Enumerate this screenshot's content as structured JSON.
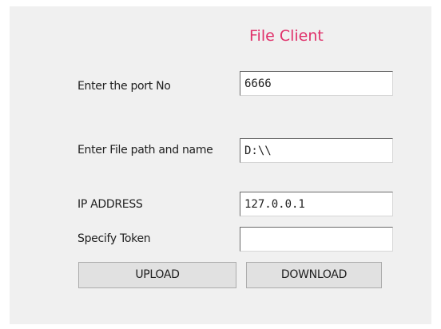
{
  "window": {
    "title": "File Client"
  },
  "form": {
    "port": {
      "label": "Enter the port No",
      "value": "6666"
    },
    "file_path": {
      "label": "Enter File path and name",
      "value": "D:\\\\"
    },
    "ip_address": {
      "label": "IP ADDRESS",
      "value": "127.0.0.1"
    },
    "token": {
      "label": "Specify Token",
      "value": ""
    }
  },
  "buttons": {
    "upload_label": "UPLOAD",
    "download_label": "DOWNLOAD"
  },
  "colors": {
    "title": "#e0306a",
    "panel_background": "#f0f0f0",
    "button_background": "#e1e1e1"
  }
}
